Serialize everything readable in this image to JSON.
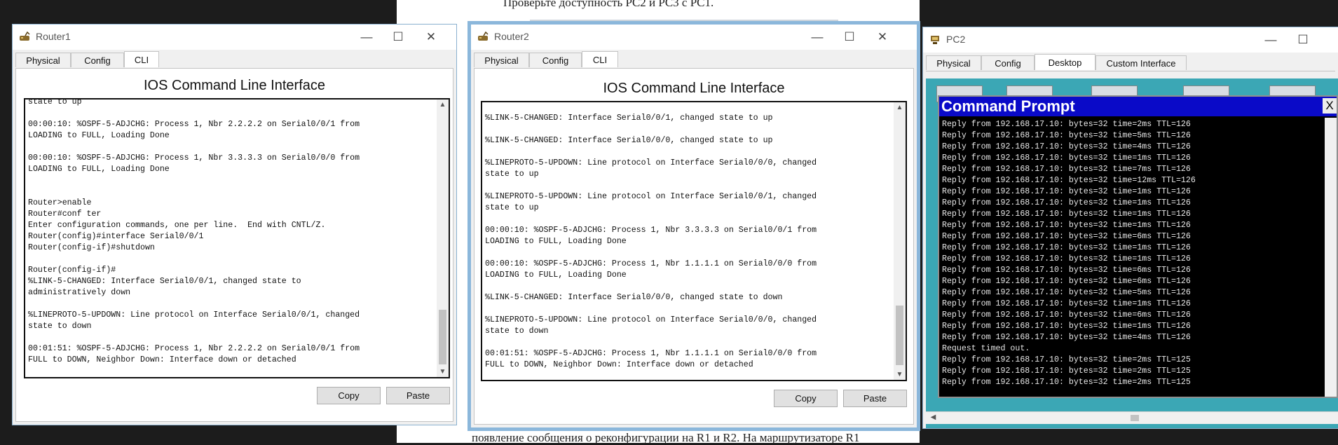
{
  "background_doc": {
    "top_line": "Проверьте доступность PC2 и PC3 с PC1.",
    "bottom_line": "появление сообщения о реконфигурации на R1 и R2. На маршрутизаторе R1"
  },
  "router1": {
    "title": "Router1",
    "tabs": [
      "Physical",
      "Config",
      "CLI"
    ],
    "selected_tab": "CLI",
    "header": "IOS Command Line Interface",
    "lines": [
      "state to up",
      "",
      "00:00:10: %OSPF-5-ADJCHG: Process 1, Nbr 2.2.2.2 on Serial0/0/1 from",
      "LOADING to FULL, Loading Done",
      "",
      "00:00:10: %OSPF-5-ADJCHG: Process 1, Nbr 3.3.3.3 on Serial0/0/0 from",
      "LOADING to FULL, Loading Done",
      "",
      "",
      "Router>enable",
      "Router#conf ter",
      "Enter configuration commands, one per line.  End with CNTL/Z.",
      "Router(config)#interface Serial0/0/1",
      "Router(config-if)#shutdown",
      "",
      "Router(config-if)#",
      "%LINK-5-CHANGED: Interface Serial0/0/1, changed state to",
      "administratively down",
      "",
      "%LINEPROTO-5-UPDOWN: Line protocol on Interface Serial0/0/1, changed",
      "state to down",
      "",
      "00:01:51: %OSPF-5-ADJCHG: Process 1, Nbr 2.2.2.2 on Serial0/0/1 from",
      "FULL to DOWN, Neighbor Down: Interface down or detached"
    ],
    "copy_label": "Copy",
    "paste_label": "Paste"
  },
  "router2": {
    "title": "Router2",
    "tabs": [
      "Physical",
      "Config",
      "CLI"
    ],
    "selected_tab": "CLI",
    "header": "IOS Command Line Interface",
    "lines": [
      "",
      "%LINK-5-CHANGED: Interface Serial0/0/1, changed state to up",
      "",
      "%LINK-5-CHANGED: Interface Serial0/0/0, changed state to up",
      "",
      "%LINEPROTO-5-UPDOWN: Line protocol on Interface Serial0/0/0, changed",
      "state to up",
      "",
      "%LINEPROTO-5-UPDOWN: Line protocol on Interface Serial0/0/1, changed",
      "state to up",
      "",
      "00:00:10: %OSPF-5-ADJCHG: Process 1, Nbr 3.3.3.3 on Serial0/0/1 from",
      "LOADING to FULL, Loading Done",
      "",
      "00:00:10: %OSPF-5-ADJCHG: Process 1, Nbr 1.1.1.1 on Serial0/0/0 from",
      "LOADING to FULL, Loading Done",
      "",
      "%LINK-5-CHANGED: Interface Serial0/0/0, changed state to down",
      "",
      "%LINEPROTO-5-UPDOWN: Line protocol on Interface Serial0/0/0, changed",
      "state to down",
      "",
      "00:01:51: %OSPF-5-ADJCHG: Process 1, Nbr 1.1.1.1 on Serial0/0/0 from",
      "FULL to DOWN, Neighbor Down: Interface down or detached"
    ],
    "copy_label": "Copy",
    "paste_label": "Paste"
  },
  "pc2": {
    "title": "PC2",
    "tabs": [
      "Physical",
      "Config",
      "Desktop",
      "Custom Interface"
    ],
    "selected_tab": "Desktop",
    "cmd_title": "Command Prompt",
    "cmd_close": "X",
    "lines": [
      "Reply from 192.168.17.10: bytes=32 time=2ms TTL=126",
      "Reply from 192.168.17.10: bytes=32 time=5ms TTL=126",
      "Reply from 192.168.17.10: bytes=32 time=4ms TTL=126",
      "Reply from 192.168.17.10: bytes=32 time=1ms TTL=126",
      "Reply from 192.168.17.10: bytes=32 time=7ms TTL=126",
      "Reply from 192.168.17.10: bytes=32 time=12ms TTL=126",
      "Reply from 192.168.17.10: bytes=32 time=1ms TTL=126",
      "Reply from 192.168.17.10: bytes=32 time=1ms TTL=126",
      "Reply from 192.168.17.10: bytes=32 time=1ms TTL=126",
      "Reply from 192.168.17.10: bytes=32 time=1ms TTL=126",
      "Reply from 192.168.17.10: bytes=32 time=6ms TTL=126",
      "Reply from 192.168.17.10: bytes=32 time=1ms TTL=126",
      "Reply from 192.168.17.10: bytes=32 time=1ms TTL=126",
      "Reply from 192.168.17.10: bytes=32 time=6ms TTL=126",
      "Reply from 192.168.17.10: bytes=32 time=6ms TTL=126",
      "Reply from 192.168.17.10: bytes=32 time=5ms TTL=126",
      "Reply from 192.168.17.10: bytes=32 time=1ms TTL=126",
      "Reply from 192.168.17.10: bytes=32 time=6ms TTL=126",
      "Reply from 192.168.17.10: bytes=32 time=1ms TTL=126",
      "Reply from 192.168.17.10: bytes=32 time=4ms TTL=126",
      "Request timed out.",
      "Reply from 192.168.17.10: bytes=32 time=2ms TTL=125",
      "Reply from 192.168.17.10: bytes=32 time=2ms TTL=125",
      "Reply from 192.168.17.10: bytes=32 time=2ms TTL=125"
    ]
  }
}
